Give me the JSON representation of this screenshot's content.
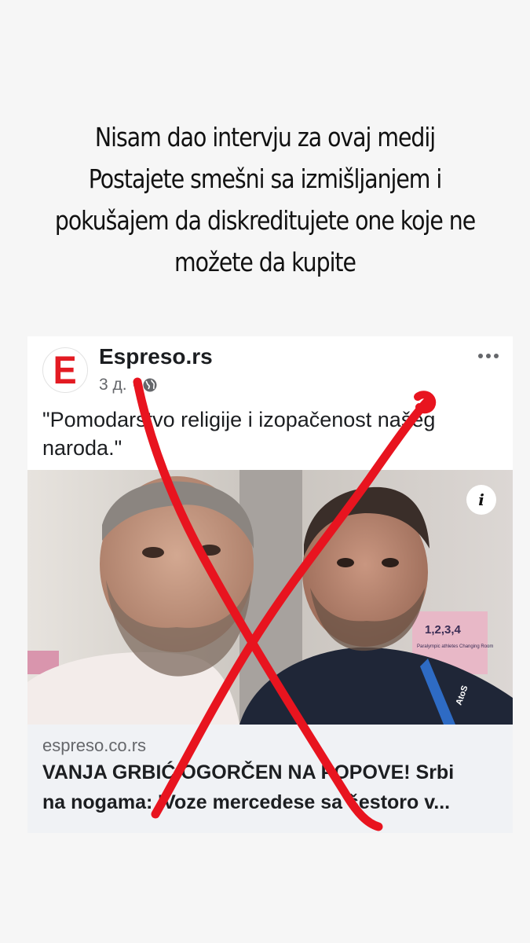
{
  "caption": {
    "lines": [
      "Nisam dao intervju za ovaj medij",
      "Postajete smešni sa izmišljanjem i",
      "pokušajem da diskreditujete one koje ne",
      "možete da kupite"
    ]
  },
  "post": {
    "page_name": "Espreso.rs",
    "avatar_letter": "E",
    "time": "3 д.",
    "separator": "·",
    "privacy_icon": "globe-icon",
    "more_icon": "more-options-icon",
    "text": "\"Pomodarstvo religije i izopačenost našeg naroda.\"",
    "photo_badge_text": "1,2,3,4",
    "photo_badge_sub": "Paralympic athletes Changing Room",
    "lanyard_text": "AtoS",
    "info_icon": "info-icon",
    "info_label": "i",
    "link": {
      "domain": "espreso.co.rs",
      "headline_line1": "VANJA GRBIĆ OGORČEN NA POPOVE! Srbi",
      "headline_line2": "na nogama: 'Voze mercedese sa šestoro v..."
    }
  },
  "colors": {
    "background": "#f6f6f6",
    "card": "#ffffff",
    "link_box": "#f0f2f5",
    "brand_red": "#e31b23",
    "cross_red": "#e8141f"
  }
}
